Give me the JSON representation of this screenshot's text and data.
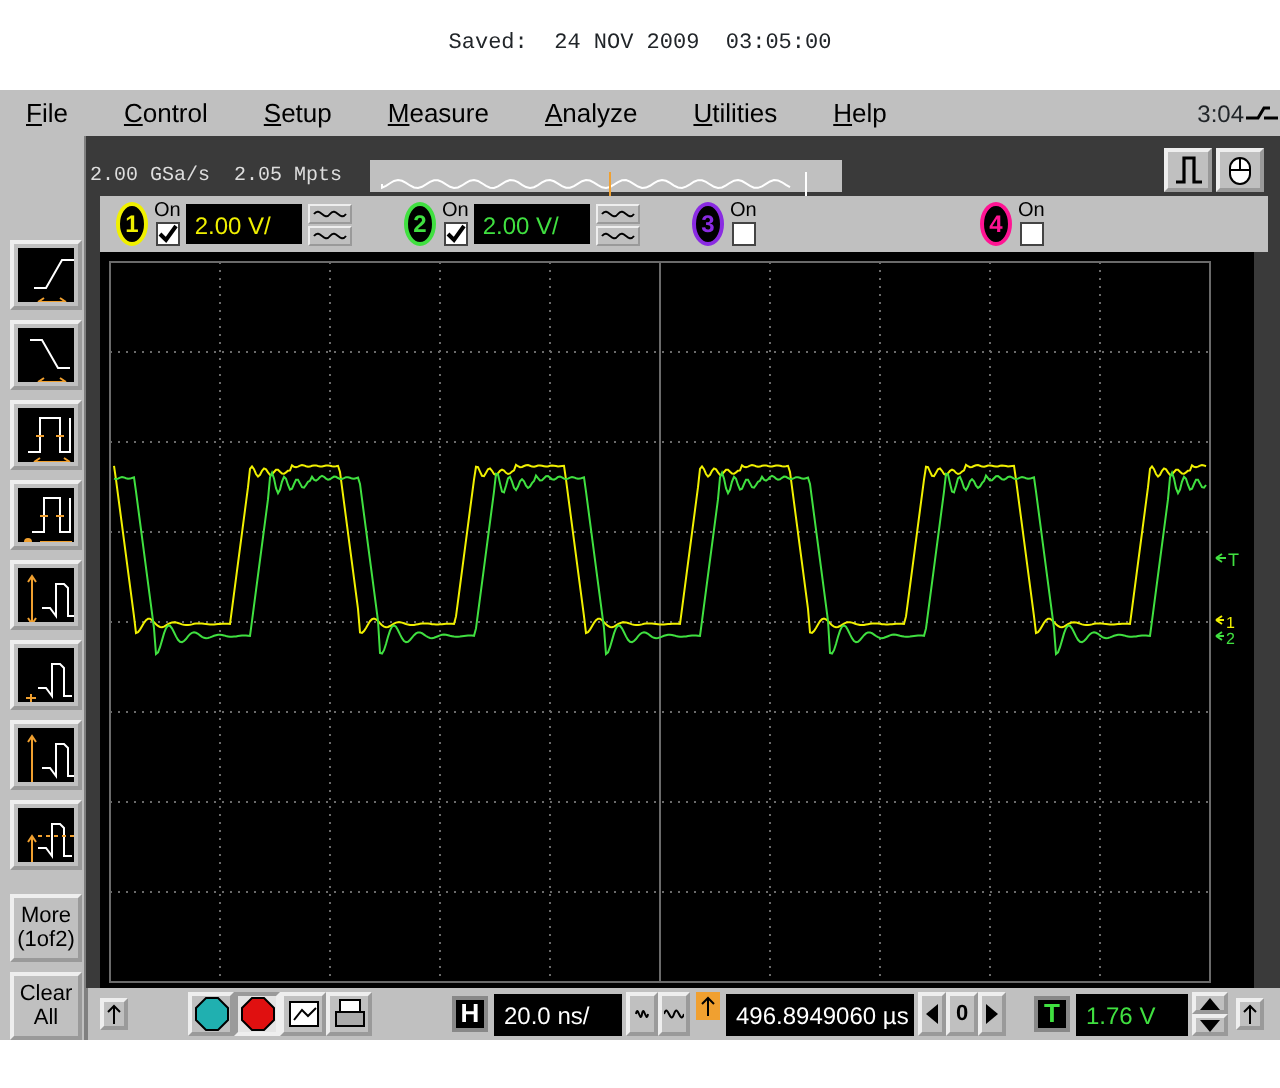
{
  "saved_banner": "Saved:  24 NOV 2009  03:05:00",
  "menu": [
    {
      "label": "File"
    },
    {
      "label": "Control"
    },
    {
      "label": "Setup"
    },
    {
      "label": "Measure"
    },
    {
      "label": "Analyze"
    },
    {
      "label": "Utilities"
    },
    {
      "label": "Help"
    }
  ],
  "clock": "3:04",
  "acquisition": {
    "sample_rate": "2.00 GSa/s",
    "memory_depth": "2.05 Mpts"
  },
  "channels": [
    {
      "number": "1",
      "color": "#f0f000",
      "on_label": "On",
      "on": true,
      "scale": "2.00 V/"
    },
    {
      "number": "2",
      "color": "#40e040",
      "on_label": "On",
      "on": true,
      "scale": "2.00 V/"
    },
    {
      "number": "3",
      "color": "#8a2be2",
      "on_label": "On",
      "on": false
    },
    {
      "number": "4",
      "color": "#ff1493",
      "on_label": "On",
      "on": false
    }
  ],
  "sidebar": {
    "buttons": [
      {
        "label": "More\n(1of2)"
      },
      {
        "label": "Clear\nAll"
      }
    ]
  },
  "trigger_marker": {
    "label": "T"
  },
  "ground_markers": [
    {
      "label": "1",
      "color": "#f0f000"
    },
    {
      "label": "2",
      "color": "#40e040"
    }
  ],
  "run_controls": [
    {
      "kind": "run",
      "selected": false
    },
    {
      "kind": "stop",
      "selected": true
    },
    {
      "kind": "quick",
      "selected": false
    },
    {
      "kind": "print",
      "selected": false
    }
  ],
  "horizontal": {
    "label": "H",
    "scale": "20.0 ns/",
    "delay": "496.8949060 µs",
    "center_button": "0"
  },
  "trigger": {
    "label": "T",
    "level": "1.76 V"
  }
}
